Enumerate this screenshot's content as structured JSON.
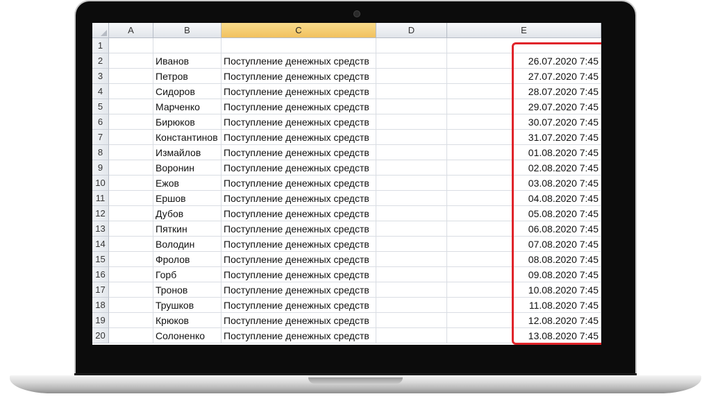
{
  "spreadsheet": {
    "columns": [
      "A",
      "B",
      "C",
      "D",
      "E"
    ],
    "selected_column": "C",
    "rows": [
      {
        "n": "1",
        "b": "",
        "c": "",
        "e": ""
      },
      {
        "n": "2",
        "b": "Иванов",
        "c": "Поступление денежных средств",
        "e": "26.07.2020 7:45"
      },
      {
        "n": "3",
        "b": "Петров",
        "c": "Поступление денежных средств",
        "e": "27.07.2020 7:45"
      },
      {
        "n": "4",
        "b": "Сидоров",
        "c": "Поступление денежных средств",
        "e": "28.07.2020 7:45"
      },
      {
        "n": "5",
        "b": "Марченко",
        "c": "Поступление денежных средств",
        "e": "29.07.2020 7:45"
      },
      {
        "n": "6",
        "b": "Бирюков",
        "c": "Поступление денежных средств",
        "e": "30.07.2020 7:45"
      },
      {
        "n": "7",
        "b": "Константинов",
        "c": "Поступление денежных средств",
        "e": "31.07.2020 7:45"
      },
      {
        "n": "8",
        "b": "Измайлов",
        "c": "Поступление денежных средств",
        "e": "01.08.2020 7:45"
      },
      {
        "n": "9",
        "b": "Воронин",
        "c": "Поступление денежных средств",
        "e": "02.08.2020 7:45"
      },
      {
        "n": "10",
        "b": "Ежов",
        "c": "Поступление денежных средств",
        "e": "03.08.2020 7:45"
      },
      {
        "n": "11",
        "b": "Ершов",
        "c": "Поступление денежных средств",
        "e": "04.08.2020 7:45"
      },
      {
        "n": "12",
        "b": "Дубов",
        "c": "Поступление денежных средств",
        "e": "05.08.2020 7:45"
      },
      {
        "n": "13",
        "b": "Пяткин",
        "c": "Поступление денежных средств",
        "e": "06.08.2020 7:45"
      },
      {
        "n": "14",
        "b": "Володин",
        "c": "Поступление денежных средств",
        "e": "07.08.2020 7:45"
      },
      {
        "n": "15",
        "b": "Фролов",
        "c": "Поступление денежных средств",
        "e": "08.08.2020 7:45"
      },
      {
        "n": "16",
        "b": "Горб",
        "c": "Поступление денежных средств",
        "e": "09.08.2020 7:45"
      },
      {
        "n": "17",
        "b": "Тронов",
        "c": "Поступление денежных средств",
        "e": "10.08.2020 7:45"
      },
      {
        "n": "18",
        "b": "Трушков",
        "c": "Поступление денежных средств",
        "e": "11.08.2020 7:45"
      },
      {
        "n": "19",
        "b": "Крюков",
        "c": "Поступление денежных средств",
        "e": "12.08.2020 7:45"
      },
      {
        "n": "20",
        "b": "Солоненко",
        "c": "Поступление денежных средств",
        "e": "13.08.2020 7:45"
      }
    ]
  },
  "colors": {
    "highlight_border": "#e0242a",
    "selected_header": "#f1c15f"
  }
}
